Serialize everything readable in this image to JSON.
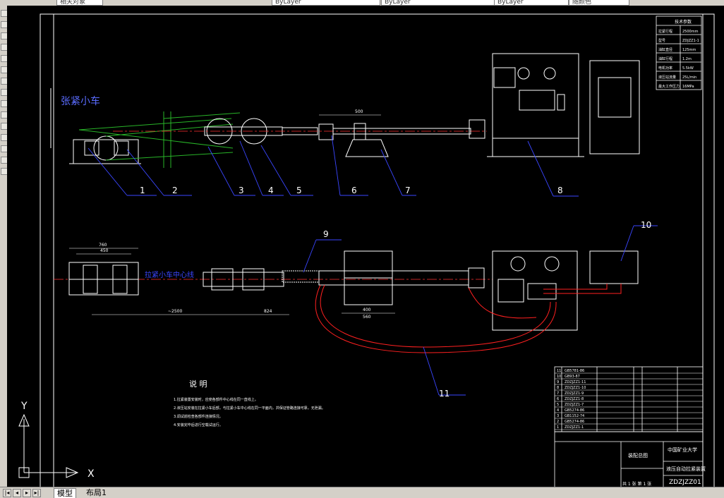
{
  "toolbar": {
    "boxes": [
      "相关对象",
      "ByLayer",
      "ByLayer",
      "ByLayer",
      "随颜色"
    ]
  },
  "tabs": {
    "model": "模型",
    "layout1": "布局1"
  },
  "drawing": {
    "cart_label": "张紧小车",
    "center_line_label": "拉紧小车中心线",
    "part_numbers": [
      "1",
      "2",
      "3",
      "4",
      "5",
      "6",
      "7",
      "8",
      "9",
      "10",
      "11"
    ],
    "dims": {
      "d500": "500",
      "d760": "760",
      "d450": "450",
      "d2500": "~2500",
      "d824": "824",
      "d400": "400",
      "d560": "560"
    },
    "notes_title": "说 明",
    "notes": [
      "1.拉紧装置安装时，应使各部件中心线在同一直线上。",
      "2.液压站安装在拉紧小车后部，与拉紧小车中心线在同一平面内，并保证管路连接可靠，无泄漏。",
      "3.调试前检查各部件连接情况。",
      "4.安装完毕后进行空载试运行。"
    ],
    "spec_table": {
      "title": "技术参数",
      "rows": [
        [
          "拉紧行程",
          "2500mm"
        ],
        [
          "型号",
          "ZDJZZ1-1"
        ],
        [
          "油缸直径",
          "125mm"
        ],
        [
          "油缸行程",
          "1.2m"
        ],
        [
          "电机功率",
          "5.5kW"
        ],
        [
          "液压站流量",
          "25L/min"
        ],
        [
          "最大工作压力",
          "16MPa"
        ]
      ]
    },
    "title_block": {
      "drawing_no": "ZDZJZZ01",
      "name": "液压自动拉紧装置",
      "school": "中国矿业大学",
      "assembly": "装配总图",
      "scale": "共 1 张 第 1 张"
    },
    "bom_codes": [
      "GB5781-86",
      "GB93-87",
      "ZDZJZZ1-11",
      "ZDZJZZ1-10",
      "ZDZJZZ1-9",
      "ZDZJZZ1-8",
      "ZDZJZZ1-7",
      "GB5274-86",
      "GB1152-74",
      "GB5274-86",
      "ZDZJZZ1-1"
    ]
  },
  "ucs": {
    "x": "X",
    "y": "Y"
  }
}
